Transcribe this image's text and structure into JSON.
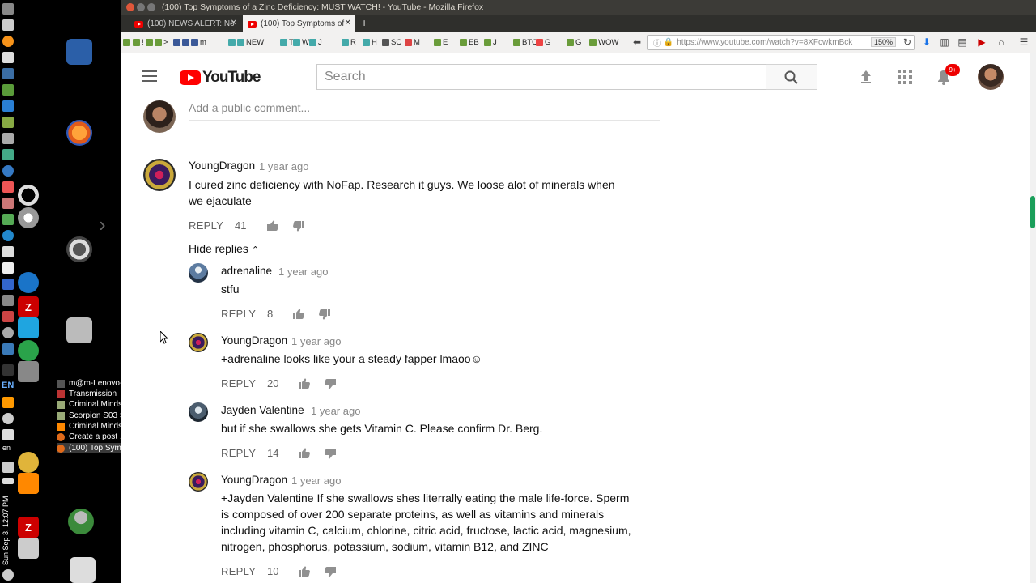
{
  "window": {
    "title": "(100) Top Symptoms of a Zinc Deficiency: MUST WATCH! - YouTube - Mozilla Firefox"
  },
  "tabs": [
    {
      "label": "(100) NEWS ALERT: No"
    },
    {
      "label": "(100) Top Symptoms of"
    }
  ],
  "bookmarks": [
    "!",
    ">",
    "m",
    "NEW",
    "T",
    "W",
    "J",
    "R",
    "H",
    "SC",
    "M",
    "E",
    "EB",
    "J",
    "BTC",
    "G",
    "G",
    "WOW"
  ],
  "url": {
    "value": "https://www.youtube.com/watch?v=8XFcwkmBck",
    "zoom": "150%"
  },
  "youtube": {
    "logo": "YouTube",
    "search_placeholder": "Search",
    "notifications_badge": "9+"
  },
  "comments": {
    "add_placeholder": "Add a public comment...",
    "hide_replies": "Hide replies",
    "reply_label": "REPLY",
    "top": {
      "author": "YoungDragon",
      "time": "1 year ago",
      "text": "I cured zinc deficiency with NoFap. Research it guys. We loose alot of minerals when we ejaculate",
      "likes": "41"
    },
    "replies": [
      {
        "author": "adrenaline",
        "time": "1 year ago",
        "text": "stfu",
        "likes": "8"
      },
      {
        "author": "YoungDragon",
        "time": "1 year ago",
        "text": "+adrenaline looks like your a steady fapper lmaoo☺",
        "likes": "20"
      },
      {
        "author": "Jayden Valentine",
        "time": "1 year ago",
        "text": "but if she swallows she gets Vitamin C. Please confirm Dr. Berg.",
        "likes": "14"
      },
      {
        "author": "YoungDragon",
        "time": "1 year ago",
        "text": "+Jayden Valentine If she swallows shes literrally eating the male life-force. Sperm is composed of over 200 separate proteins, as well as vitamins and minerals including vitamin C, calcium, chlorine, citric acid, fructose, lactic acid, magnesium, nitrogen, phosphorus, potassium, sodium, vitamin B12, and ZINC",
        "likes": "10"
      }
    ]
  },
  "taskbar": [
    {
      "label": "m@m-Lenovo-..."
    },
    {
      "label": "Transmission"
    },
    {
      "label": "Criminal.Minds..."
    },
    {
      "label": "Scorpion S03 S..."
    },
    {
      "label": "Criminal Minds..."
    },
    {
      "label": "Create a post ..."
    },
    {
      "label": "(100) Top Symp..."
    }
  ],
  "system": {
    "keyboard": "EN",
    "lang": "en",
    "clock": "Sun Sep 3, 12:07 PM"
  }
}
